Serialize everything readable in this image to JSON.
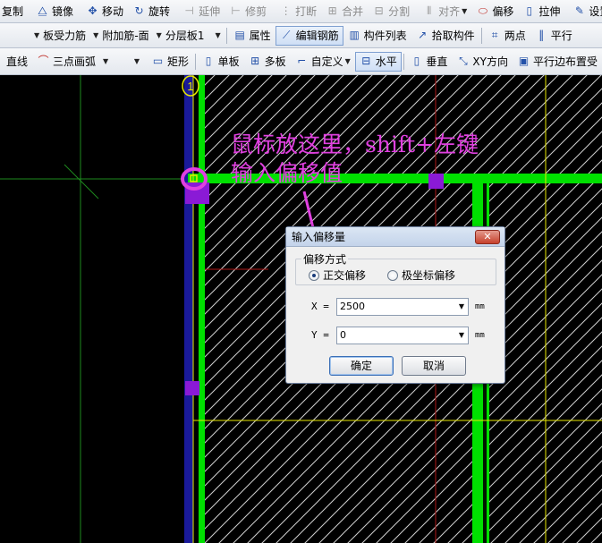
{
  "colors": {
    "wall": "#00e000",
    "left_beam": "#1a1a9a",
    "purple": "#8a1ad6",
    "annotation": "#e040e0",
    "axis_red": "#b01818",
    "axis_green": "#1e8a1e",
    "yellow_line": "#e8e800",
    "hatch": "#d8d8d8"
  },
  "toolbar_row1": [
    {
      "label": "复制",
      "icon": "copy-icon",
      "glyph": "",
      "disabled": false
    },
    {
      "label": "镜像",
      "icon": "mirror-icon",
      "glyph": "⧋",
      "disabled": false
    },
    {
      "label": "移动",
      "icon": "move-icon",
      "glyph": "✥",
      "disabled": false
    },
    {
      "label": "旋转",
      "icon": "rotate-icon",
      "glyph": "↻",
      "disabled": false
    },
    {
      "label": "延伸",
      "icon": "extend-icon",
      "glyph": "⊣",
      "disabled": true
    },
    {
      "label": "修剪",
      "icon": "trim-icon",
      "glyph": "⊢",
      "disabled": true
    },
    {
      "label": "打断",
      "icon": "break-icon",
      "glyph": "⋮",
      "disabled": true
    },
    {
      "label": "合并",
      "icon": "merge-icon",
      "glyph": "⊞",
      "disabled": true
    },
    {
      "label": "分割",
      "icon": "split-icon",
      "glyph": "⊟",
      "disabled": true
    },
    {
      "label": "对齐",
      "icon": "align-icon",
      "glyph": "⫴",
      "disabled": true,
      "dropdown": true
    },
    {
      "label": "偏移",
      "icon": "offset-icon",
      "glyph": "⬭",
      "disabled": false
    },
    {
      "label": "拉伸",
      "icon": "stretch-icon",
      "glyph": "▯",
      "disabled": false
    },
    {
      "label": "设置夹",
      "icon": "pencil-icon",
      "glyph": "✎",
      "disabled": false
    }
  ],
  "toolbar_row2": {
    "combo_rebar": "板受力筋",
    "combo_extra": "附加筋-面",
    "combo_layer": "分层板1",
    "buttons": [
      {
        "label": "属性",
        "icon": "properties-icon",
        "glyph": "▤",
        "pressed": false
      },
      {
        "label": "编辑钢筋",
        "icon": "edit-rebar-icon",
        "glyph": "⟋",
        "pressed": true
      },
      {
        "label": "构件列表",
        "icon": "component-list-icon",
        "glyph": "▥",
        "pressed": false
      },
      {
        "label": "拾取构件",
        "icon": "pick-icon",
        "glyph": "↗",
        "pressed": false
      },
      {
        "label": "两点",
        "icon": "two-point-icon",
        "glyph": "⌗",
        "pressed": false
      },
      {
        "label": "平行",
        "icon": "parallel-icon",
        "glyph": "‖",
        "pressed": false
      }
    ]
  },
  "toolbar_row3": {
    "line_label": "直线",
    "arc_label": "三点画弧",
    "rect_label": "矩形",
    "single_label": "单板",
    "multi_label": "多板",
    "custom_label": "自定义",
    "horizontal_label": "水平",
    "vertical_label": "垂直",
    "xy_label": "XY方向",
    "parallel_edge_label": "平行边布置受"
  },
  "canvas": {
    "axis_marker": "1",
    "annotation_line1": "鼠标放这里，shift+左键",
    "annotation_line2": "输入偏移值"
  },
  "dialog": {
    "title": "输入偏移量",
    "close": "✕",
    "group_label": "偏移方式",
    "option_ortho": "正交偏移",
    "option_polar": "极坐标偏移",
    "selected_option": "ortho",
    "x_label": "X =",
    "x_value": "2500",
    "x_unit": "mm",
    "y_label": "Y =",
    "y_value": "0",
    "y_unit": "mm",
    "ok_label": "确定",
    "cancel_label": "取消"
  }
}
